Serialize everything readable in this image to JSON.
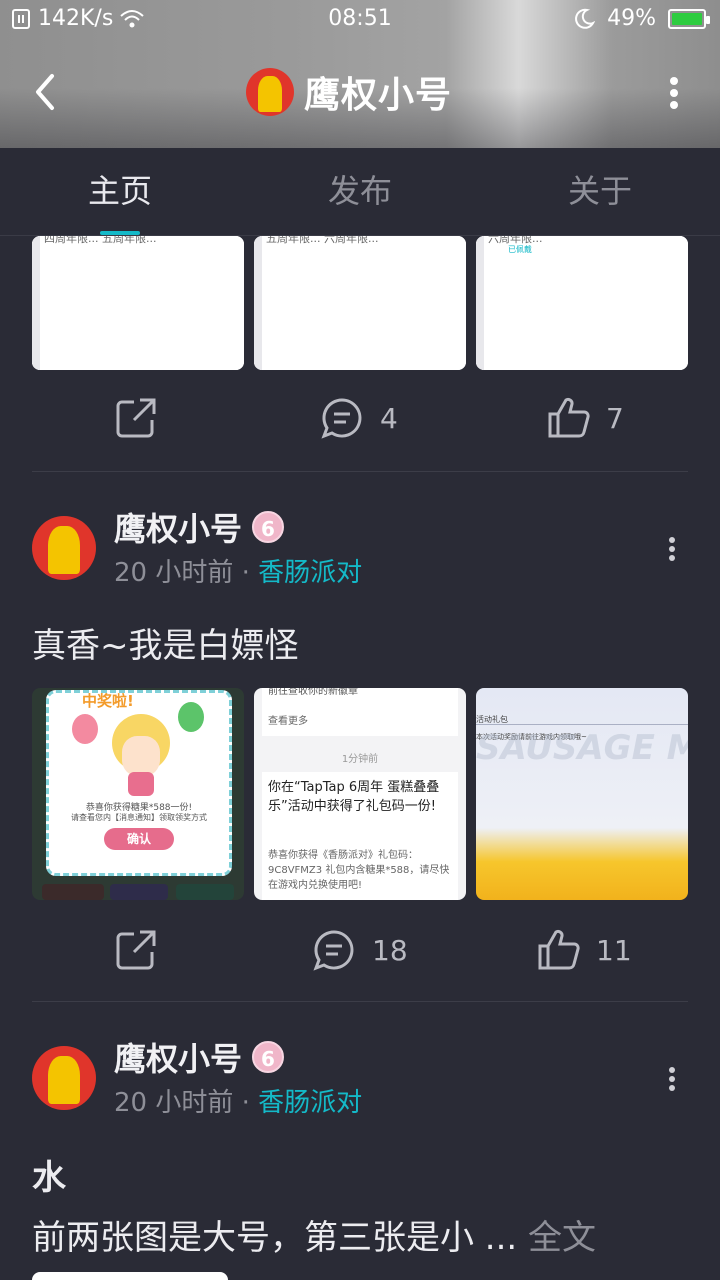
{
  "status": {
    "network_speed": "142K/s",
    "time": "08:51",
    "battery": "49%"
  },
  "header": {
    "title": "鹰权小号"
  },
  "tabs": [
    {
      "label": "主页",
      "active": true
    },
    {
      "label": "发布",
      "active": false
    },
    {
      "label": "关于",
      "active": false
    }
  ],
  "post0": {
    "thumb_captions": [
      "四周年限...  五周年限...",
      "五周年限...  六周年限...",
      "六周年限..."
    ],
    "thumb_tag": "已佩戴",
    "comments": "4",
    "likes": "7"
  },
  "post1": {
    "author": "鹰权小号",
    "badge": "6",
    "time": "20 小时前",
    "sep": "·",
    "game": "香肠派对",
    "text": "真香~我是白嫖怪",
    "img1": {
      "title": "中奖啦!",
      "line1": "恭喜你获得糖果*588一份!",
      "line2": "请查看您内【消息通知】领取领奖方式",
      "button": "确认"
    },
    "img2": {
      "top": "前往查收你的新徽章",
      "more": "查看更多",
      "time": "1分钟前",
      "title": "你在“TapTap 6周年 蛋糕叠叠乐”活动中获得了礼包码一份!",
      "body": "恭喜你获得《香肠派对》礼包码：9C8VFMZ3 礼包内含糖果*588，请尽快在游戏内兑换使用吧!"
    },
    "img3": {
      "title": "活动礼包",
      "body": "本次活动奖励请前往游戏内领取哦~",
      "watermark": "SAUSAGE MAN"
    },
    "comments": "18",
    "likes": "11"
  },
  "post2": {
    "author": "鹰权小号",
    "badge": "6",
    "time": "20 小时前",
    "sep": "·",
    "game": "香肠派对",
    "title": "水",
    "text": "前两张图是大号，第三张是小 ...",
    "full": "全文"
  },
  "colors": {
    "accent": "#14b9c8",
    "background": "#2a2b36",
    "avatar_red": "#e0352b"
  }
}
